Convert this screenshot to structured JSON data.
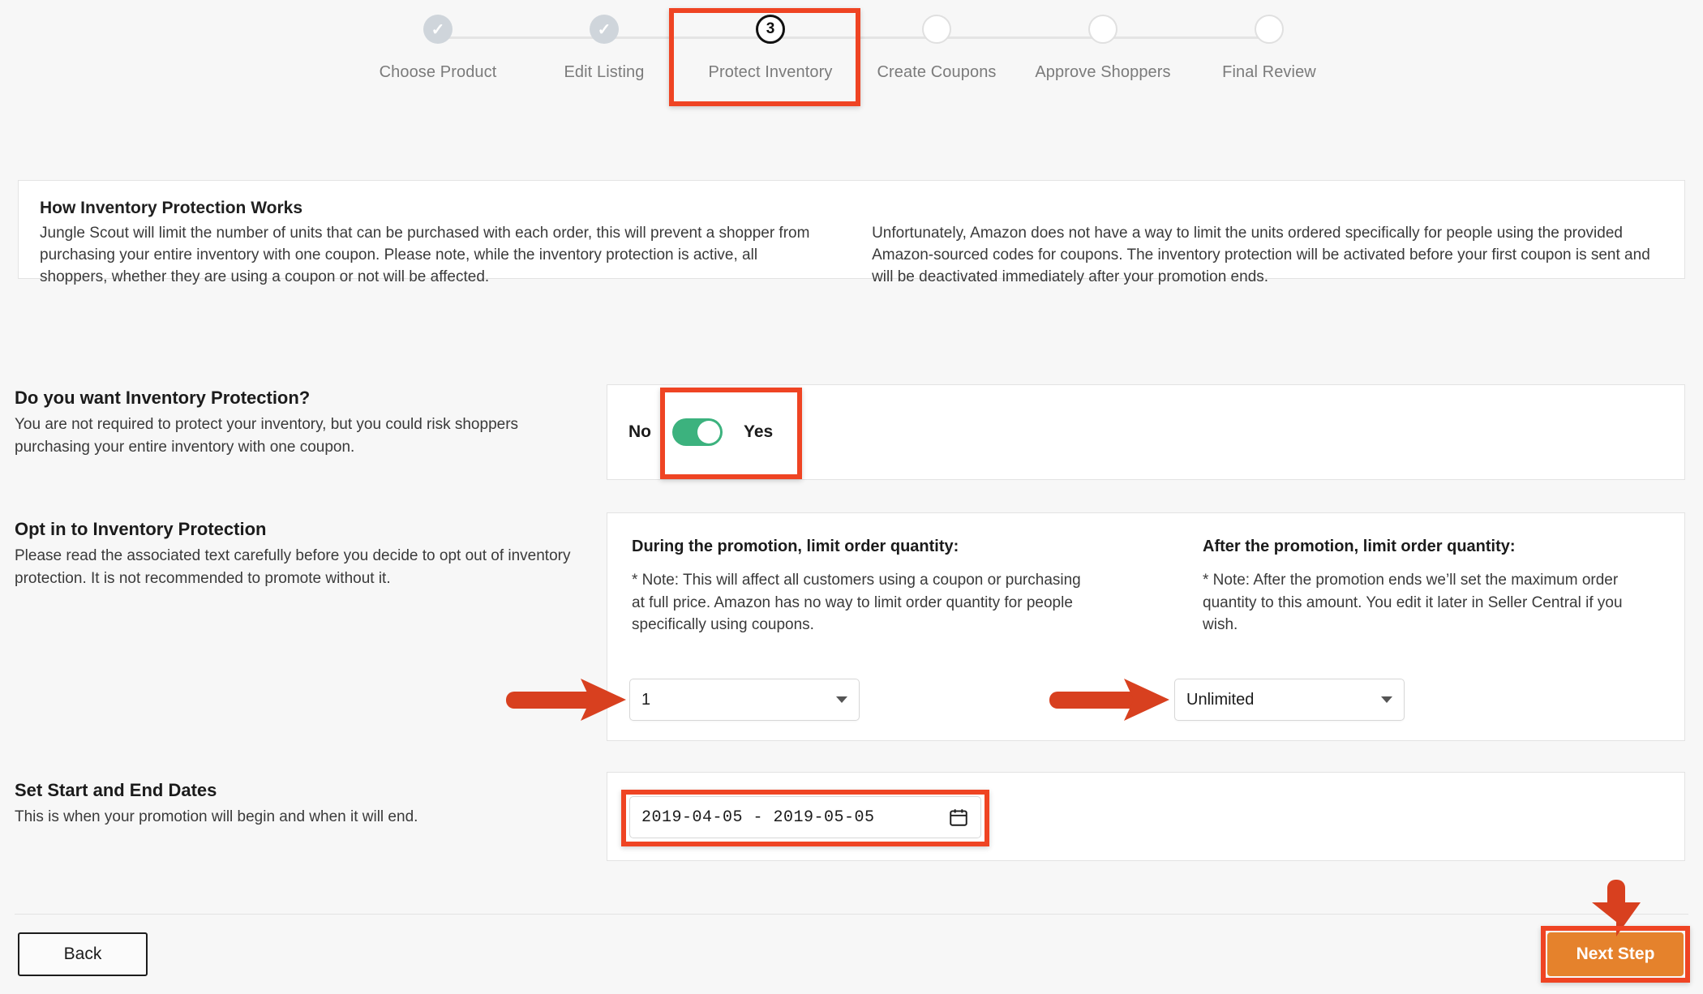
{
  "stepper": {
    "steps": [
      {
        "label": "Choose Product",
        "state": "done",
        "marker": "✓"
      },
      {
        "label": "Edit Listing",
        "state": "done",
        "marker": "✓"
      },
      {
        "label": "Protect Inventory",
        "state": "current",
        "marker": "3"
      },
      {
        "label": "Create Coupons",
        "state": "todo",
        "marker": ""
      },
      {
        "label": "Approve Shoppers",
        "state": "todo",
        "marker": ""
      },
      {
        "label": "Final Review",
        "state": "todo",
        "marker": ""
      }
    ]
  },
  "info": {
    "title": "How Inventory Protection Works",
    "left": "Jungle Scout will limit the number of units that can be purchased with each order, this will prevent a shopper from purchasing your entire inventory with one coupon. Please note, while the inventory protection is active, all shoppers, whether they are using a coupon or not will be affected.",
    "right": "Unfortunately, Amazon does not have a way to limit the units ordered specifically for people using the provided Amazon-sourced codes for coupons. The inventory protection will be activated before your first coupon is sent and will be deactivated immediately after your promotion ends."
  },
  "protection": {
    "title": "Do you want Inventory Protection?",
    "description": "You are not required to protect your inventory, but you could risk shoppers purchasing your entire inventory with one coupon.",
    "toggle_off_label": "No",
    "toggle_on_label": "Yes",
    "toggle_state": "Yes"
  },
  "optin": {
    "title": "Opt in to Inventory Protection",
    "description": "Please read the associated text carefully before you decide to opt out of inventory protection. It is not recommended to promote without it.",
    "during": {
      "heading": "During the promotion, limit order quantity:",
      "note": "* Note: This will affect all customers using a coupon or purchasing at full price. Amazon has no way to limit order quantity for people specifically using coupons.",
      "value": "1"
    },
    "after": {
      "heading": "After the promotion, limit order quantity:",
      "note": "* Note: After the promotion ends we’ll set the maximum order quantity to this amount. You edit it later in Seller Central if you wish.",
      "value": "Unlimited"
    }
  },
  "dates": {
    "title": "Set Start and End Dates",
    "description": "This is when your promotion will begin and when it will end.",
    "value": "2019-04-05 - 2019-05-05",
    "icon": "calendar-icon"
  },
  "footer": {
    "back_label": "Back",
    "next_label": "Next Step"
  },
  "colors": {
    "annotation": "#ef4423",
    "toggle_on": "#3cb27e",
    "next_button": "#e5822c",
    "page_background": "#f7f7f7"
  }
}
